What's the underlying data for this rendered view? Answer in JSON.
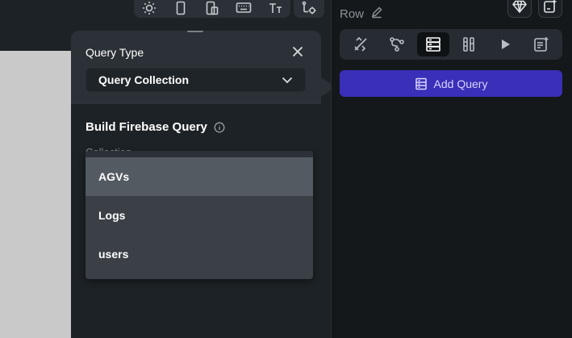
{
  "toolbar": {
    "icons": [
      "sun-icon",
      "phone-icon",
      "tablet-icon",
      "keyboard-icon",
      "text-size-icon",
      "settings-icon"
    ]
  },
  "right_panel": {
    "element_label": "Row",
    "top_buttons": [
      "gem-icon",
      "add-widget-icon"
    ],
    "tabs": [
      "properties-icon",
      "actions-icon",
      "backend-query-icon",
      "align-icon",
      "play-icon",
      "notes-icon"
    ],
    "active_tab": "backend-query-icon",
    "add_query_label": "Add Query",
    "accent": "#3a2fb8"
  },
  "popover": {
    "title": "Query Type",
    "query_type_value": "Query Collection",
    "section_title": "Build Firebase Query",
    "collection_label": "Collection"
  },
  "dropdown": {
    "options": [
      {
        "label": "AGVs",
        "hovered": true
      },
      {
        "label": "Logs",
        "hovered": false
      },
      {
        "label": "users",
        "hovered": false
      }
    ]
  }
}
